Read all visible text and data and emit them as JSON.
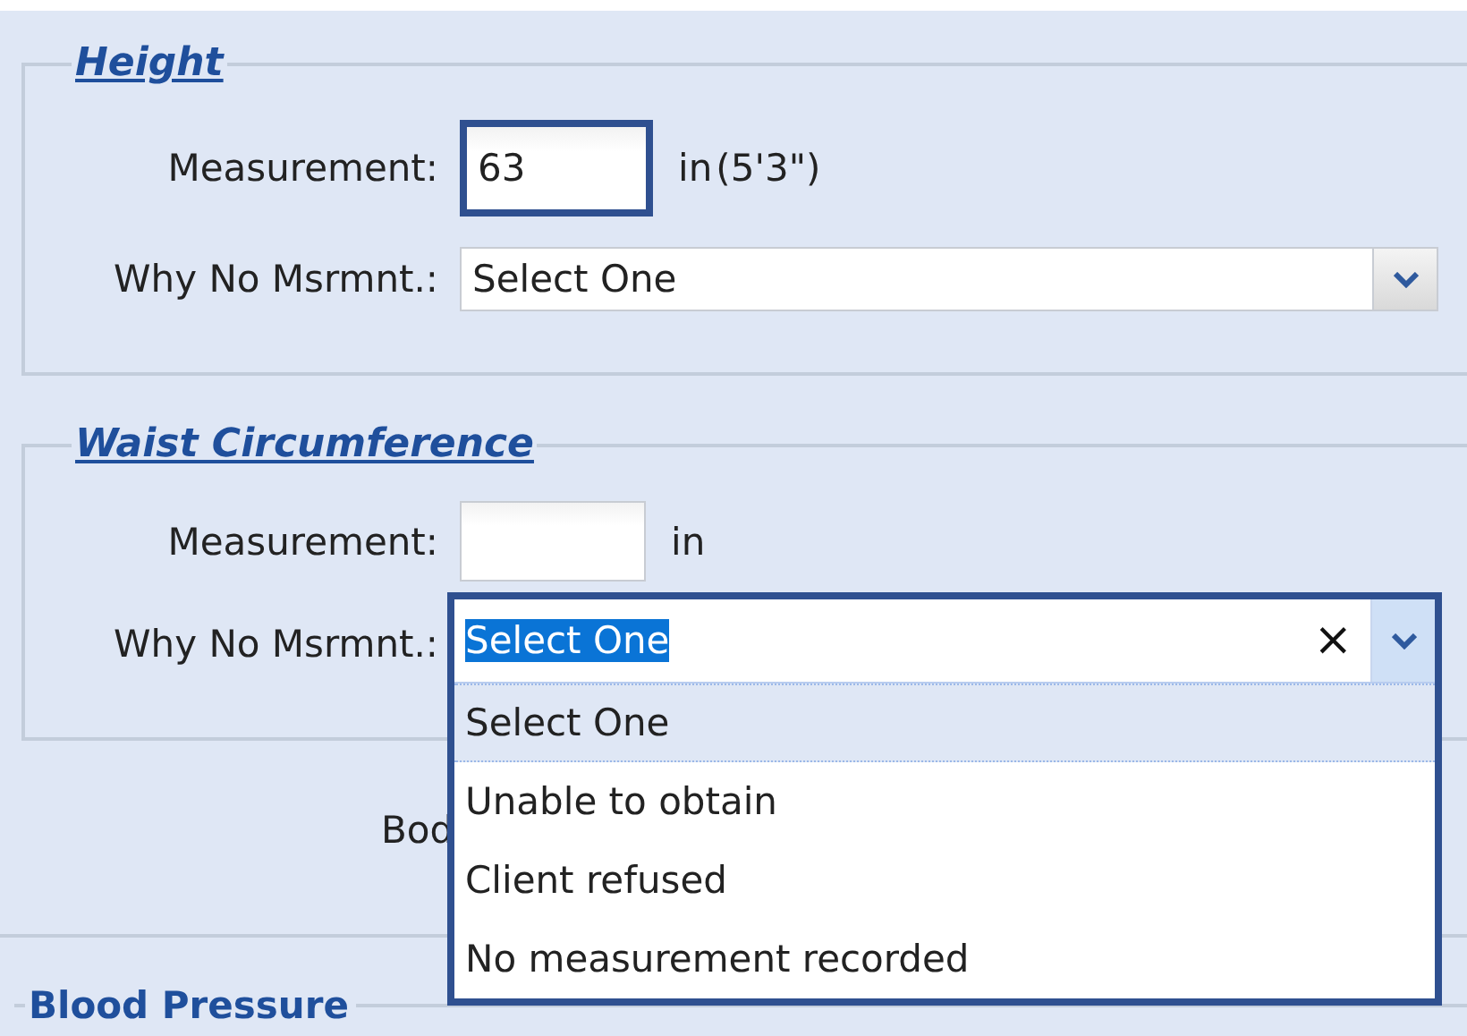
{
  "sections": [
    {
      "legend": "Height",
      "measurement": {
        "label": "Measurement:",
        "value": "63",
        "unit": "in",
        "note": "(5'3\")",
        "focused": true
      },
      "reason": {
        "label": "Why No Msrmnt.:",
        "value": "Select One",
        "focused": false,
        "expanded": false
      }
    },
    {
      "legend": "Waist Circumference",
      "measurement": {
        "label": "Measurement:",
        "unit": "in",
        "focused": false
      },
      "reason": {
        "label": "Why No Msrmnt.:",
        "value": "Select One",
        "text_selected": true,
        "focused": true,
        "expanded": true,
        "clear_button": "×",
        "options": [
          {
            "label": "Select One",
            "selected": true
          },
          {
            "label": "Unable to obtain",
            "selected": false
          },
          {
            "label": "Client refused",
            "selected": false
          },
          {
            "label": "No measurement recorded",
            "selected": false
          }
        ]
      }
    }
  ],
  "body_label": "Bod",
  "next_section": {
    "legend": "Blood Pressure"
  }
}
